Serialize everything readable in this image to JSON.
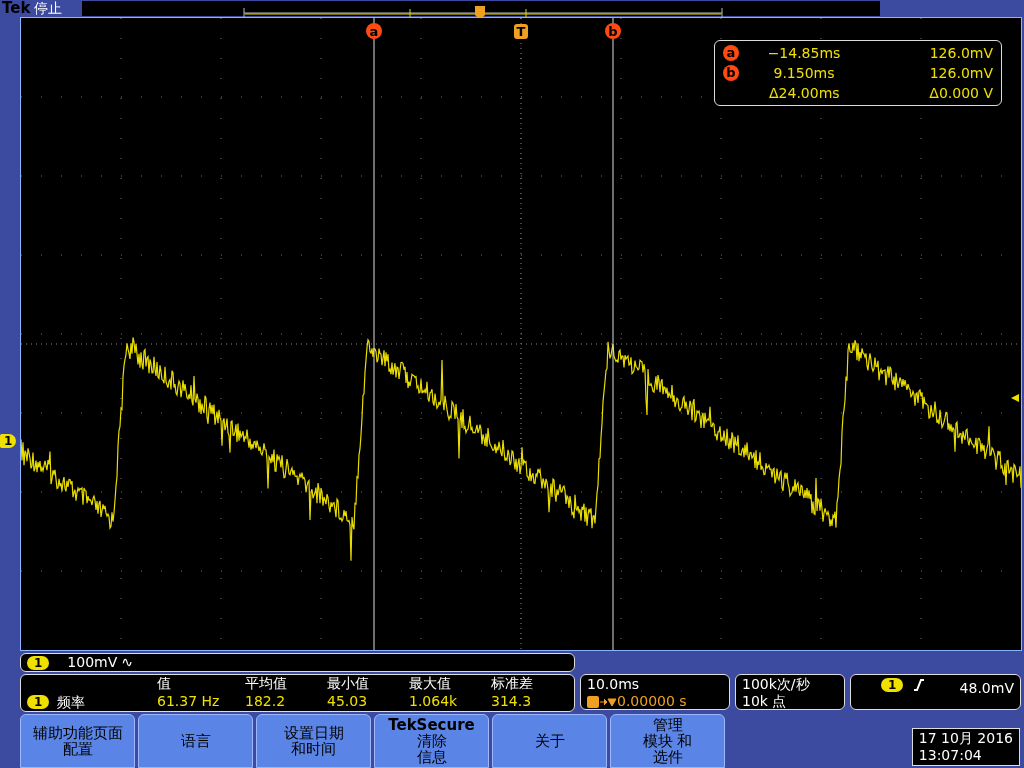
{
  "header": {
    "brand": "Tek",
    "status": "停止"
  },
  "cursor_markers": [
    {
      "label": "a",
      "kind": "cursor"
    },
    {
      "label": "T",
      "kind": "trigger"
    },
    {
      "label": "b",
      "kind": "cursor"
    }
  ],
  "channel_marker": "1",
  "cursor_readout": {
    "rows": [
      {
        "marker": "a",
        "time": "−14.85ms",
        "value": "126.0mV"
      },
      {
        "marker": "b",
        "time": "9.150ms",
        "value": "126.0mV"
      }
    ],
    "delta": {
      "time": "Δ24.00ms",
      "value": "Δ0.000 V"
    }
  },
  "channel_bar": {
    "channel": "1",
    "scale": "100mV",
    "coupling": "∿"
  },
  "measurements": {
    "headers": [
      "值",
      "平均值",
      "最小值",
      "最大值",
      "标准差"
    ],
    "channel": "1",
    "name": "频率",
    "values": [
      "61.37 Hz",
      "182.2",
      "45.03",
      "1.064k",
      "314.3"
    ]
  },
  "timebase": {
    "scale": "10.0ms",
    "position": "0.00000 s"
  },
  "acquisition": {
    "rate": "100k次/秒",
    "points": "10k 点"
  },
  "trigger": {
    "channel": "1",
    "level": "48.0mV"
  },
  "menu_buttons": [
    {
      "lines": [
        {
          "text": "辅助功能页面",
          "bold": false
        },
        {
          "text": "配置",
          "bold": false
        }
      ]
    },
    {
      "lines": [
        {
          "text": "语言",
          "bold": false
        }
      ]
    },
    {
      "lines": [
        {
          "text": "设置日期",
          "bold": false
        },
        {
          "text": "和时间",
          "bold": false
        }
      ]
    },
    {
      "lines": [
        {
          "text": "TekSecure",
          "bold": true
        },
        {
          "text": "清除",
          "bold": false
        },
        {
          "text": "信息",
          "bold": false
        }
      ]
    },
    {
      "lines": [
        {
          "text": "关于",
          "bold": false
        }
      ]
    },
    {
      "lines": [
        {
          "text": "管理",
          "bold": false
        },
        {
          "text": "模块 和",
          "bold": false
        },
        {
          "text": "选件",
          "bold": false
        }
      ]
    }
  ],
  "datetime": {
    "date": "17 10月 2016",
    "time": "13:07:04"
  }
}
